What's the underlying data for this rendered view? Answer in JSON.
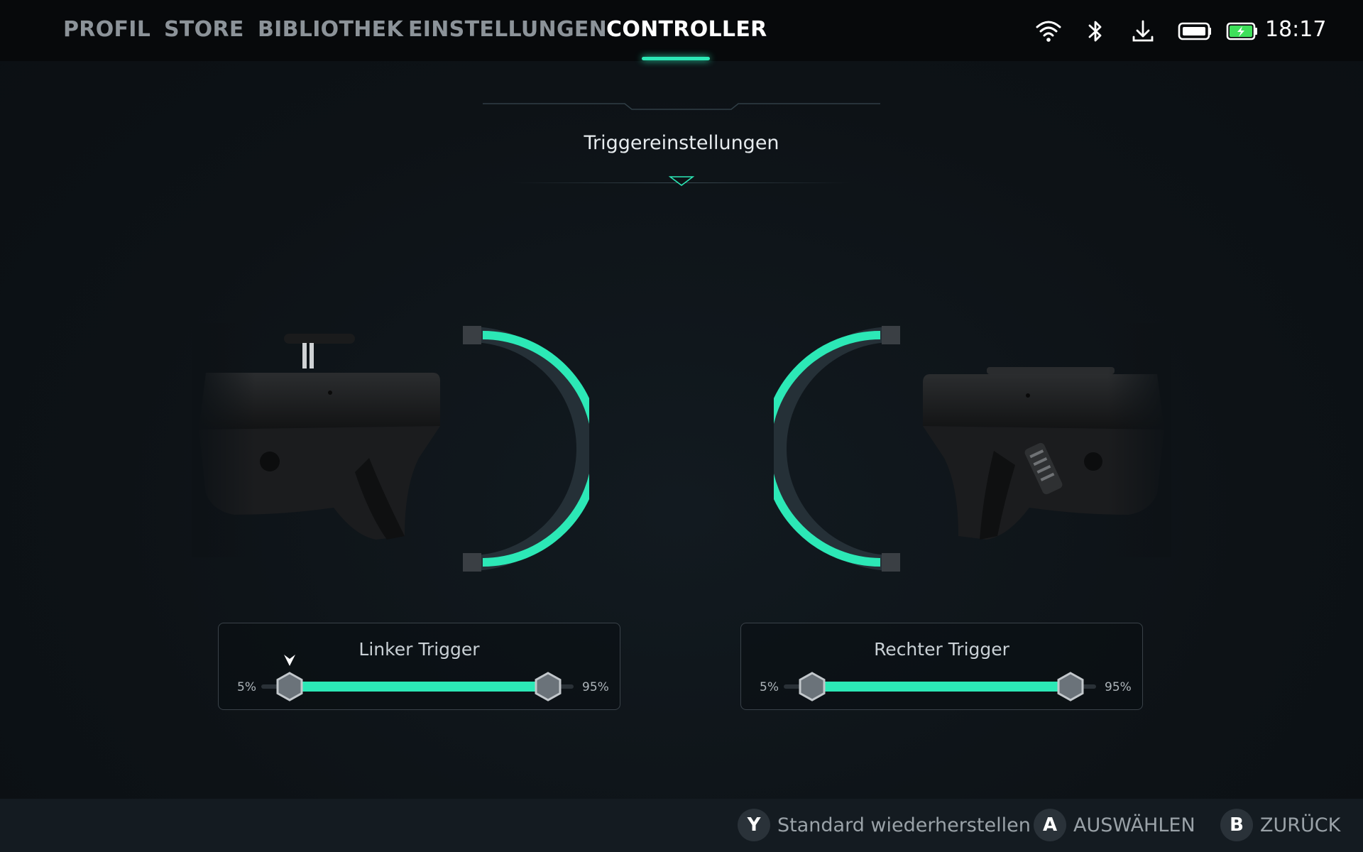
{
  "nav": {
    "tabs": [
      {
        "label": "PROFIL"
      },
      {
        "label": "STORE"
      },
      {
        "label": "BIBLIOTHEK"
      },
      {
        "label": "EINSTELLUNGEN"
      },
      {
        "label": "CONTROLLER"
      }
    ],
    "active_tab": "CONTROLLER"
  },
  "status": {
    "icons": [
      "wifi-icon",
      "bluetooth-icon",
      "download-icon",
      "controller-battery-icon",
      "battery-charging-icon"
    ],
    "time": "18:17"
  },
  "section": {
    "title": "Triggereinstellungen"
  },
  "triggers": {
    "left": {
      "title": "Linker Trigger",
      "min_label": "5%",
      "max_label": "95%",
      "range_start": 5,
      "range_end": 95
    },
    "right": {
      "title": "Rechter Trigger",
      "min_label": "5%",
      "max_label": "95%",
      "range_start": 5,
      "range_end": 95
    }
  },
  "footer": {
    "hints": [
      {
        "key": "Y",
        "label": "Standard wiederherstellen"
      },
      {
        "key": "A",
        "label": "AUSWÄHLEN"
      },
      {
        "key": "B",
        "label": "ZURÜCK"
      }
    ]
  },
  "colors": {
    "accent": "#2ce8b6",
    "background": "#0d1216",
    "topbar": "#07090b",
    "bottombar": "#141b21"
  }
}
